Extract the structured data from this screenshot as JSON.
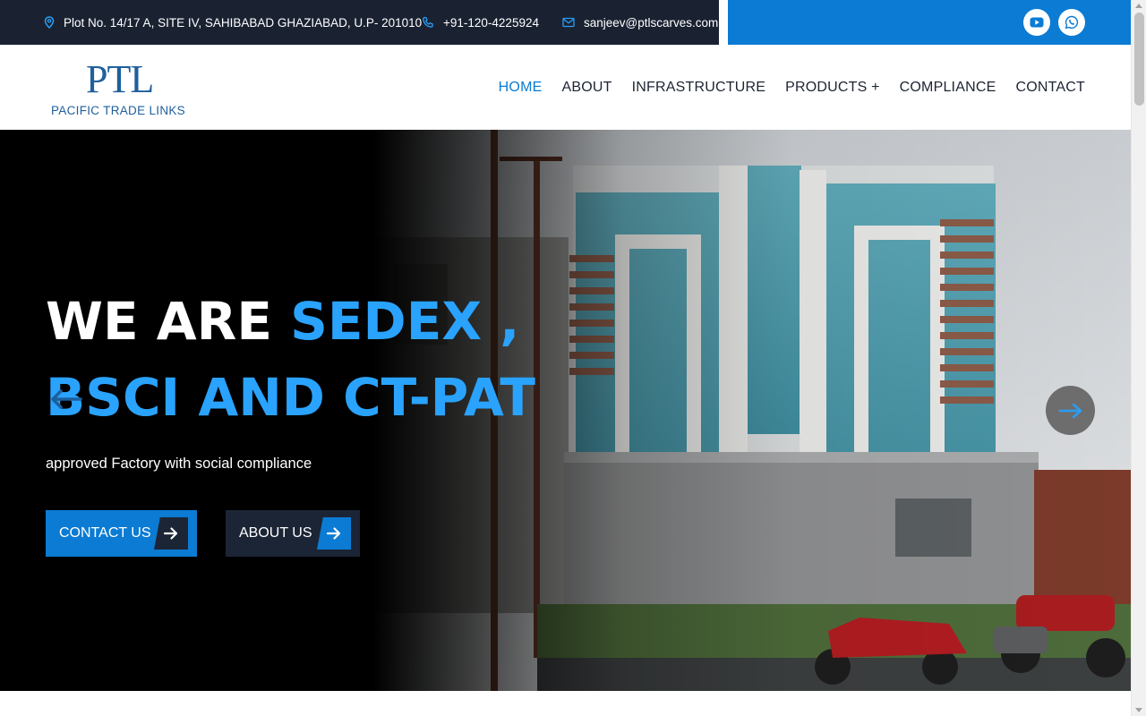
{
  "topbar": {
    "address": "Plot No. 14/17 A, SITE IV, SAHIBABAD GHAZIABAD, U.P- 201010",
    "phone": "+91-120-4225924",
    "email": "sanjeev@ptlscarves.com",
    "social": [
      {
        "name": "youtube-icon"
      },
      {
        "name": "whatsapp-icon"
      }
    ]
  },
  "brand": {
    "mark": "PTL",
    "name": "PACIFIC TRADE LINKS"
  },
  "nav": {
    "items": [
      {
        "label": "HOME",
        "active": true
      },
      {
        "label": "ABOUT"
      },
      {
        "label": "INFRASTRUCTURE"
      },
      {
        "label": "PRODUCTS +"
      },
      {
        "label": "COMPLIANCE"
      },
      {
        "label": "CONTACT"
      }
    ]
  },
  "hero": {
    "title_white": "WE ARE ",
    "title_accent_1": "SEDEX ,",
    "title_accent_2": "BSCI AND CT-PAT",
    "subtitle": "approved Factory with social compliance",
    "buttons": {
      "contact": "CONTACT US",
      "about": "ABOUT US"
    }
  },
  "colors": {
    "primary": "#0b7bd3",
    "dark": "#1a2232",
    "accent_text": "#2aa3ff"
  }
}
